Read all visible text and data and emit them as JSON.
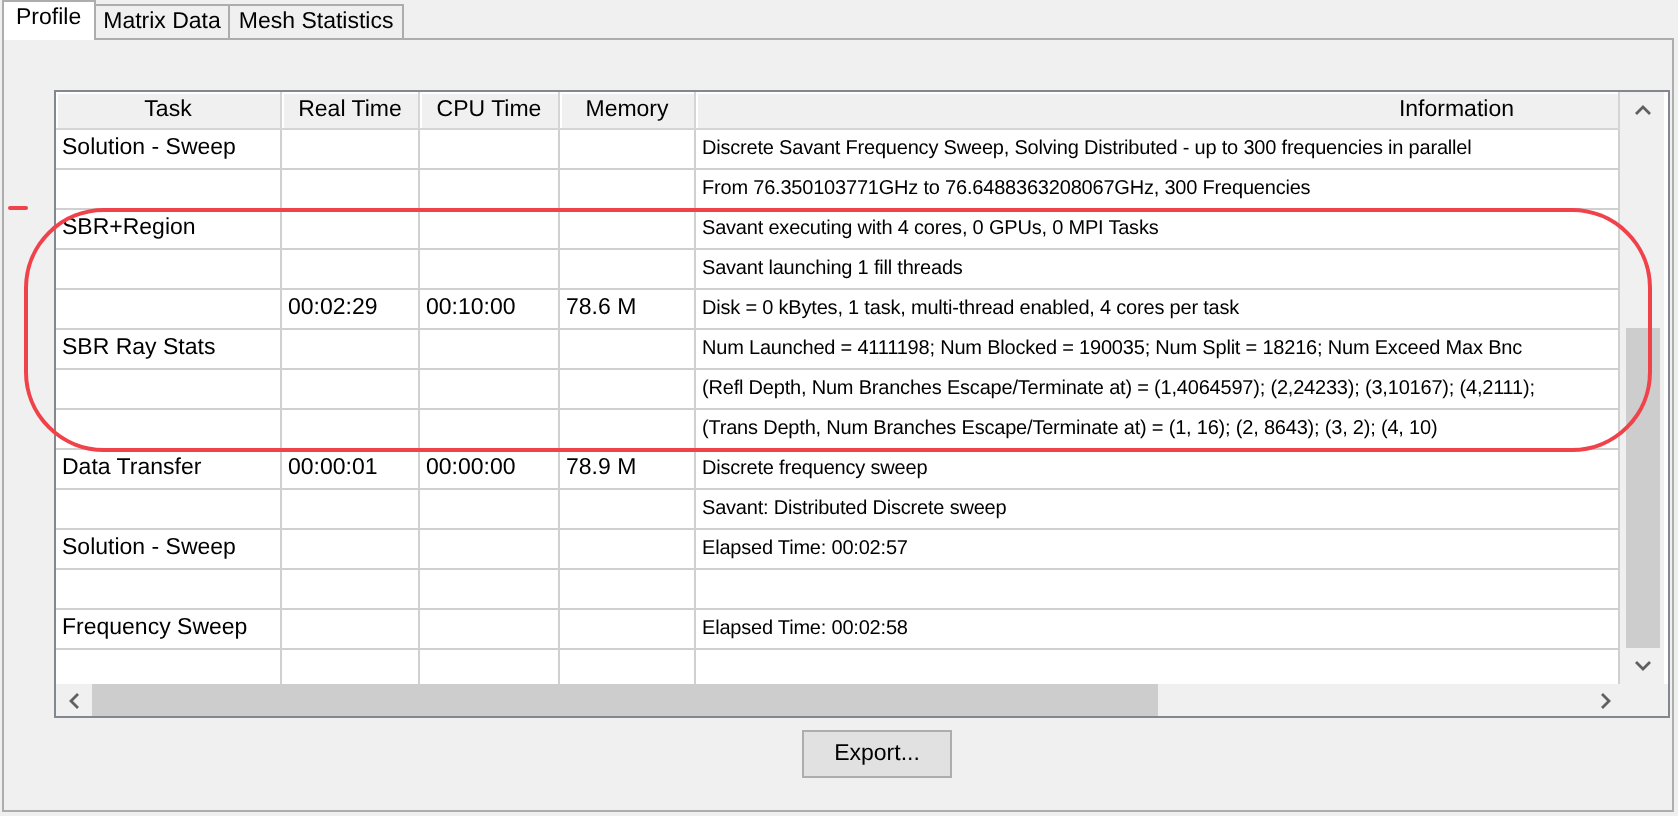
{
  "tabs": [
    {
      "label": "Profile",
      "selected": true
    },
    {
      "label": "Matrix Data",
      "selected": false
    },
    {
      "label": "Mesh Statistics",
      "selected": false
    }
  ],
  "table": {
    "columns": [
      "Task",
      "Real Time",
      "CPU Time",
      "Memory",
      "Information"
    ],
    "rows": [
      [
        "Solution - Sweep",
        "",
        "",
        "",
        "Discrete Savant Frequency Sweep, Solving Distributed - up to 300 frequencies in parallel"
      ],
      [
        "",
        "",
        "",
        "",
        "From 76.350103771GHz to 76.6488363208067GHz, 300 Frequencies"
      ],
      [
        "SBR+Region",
        "",
        "",
        "",
        "Savant executing with 4 cores, 0 GPUs, 0 MPI Tasks"
      ],
      [
        "",
        "",
        "",
        "",
        "Savant launching 1 fill threads"
      ],
      [
        "",
        "00:02:29",
        "00:10:00",
        "78.6 M",
        "Disk = 0 kBytes, 1 task, multi-thread enabled, 4 cores per task"
      ],
      [
        "SBR Ray Stats",
        "",
        "",
        "",
        "Num Launched = 4111198; Num Blocked = 190035; Num Split = 18216; Num Exceed Max Bnc"
      ],
      [
        "",
        "",
        "",
        "",
        "(Refl Depth, Num Branches Escape/Terminate at) = (1,4064597); (2,24233); (3,10167); (4,2111);"
      ],
      [
        "",
        "",
        "",
        "",
        "(Trans Depth, Num Branches Escape/Terminate at) = (1, 16); (2, 8643); (3, 2); (4, 10)"
      ],
      [
        "Data Transfer",
        "00:00:01",
        "00:00:00",
        "78.9 M",
        "Discrete frequency sweep"
      ],
      [
        "",
        "",
        "",
        "",
        "Savant: Distributed Discrete sweep"
      ],
      [
        "Solution - Sweep",
        "",
        "",
        "",
        "Elapsed Time: 00:02:57"
      ],
      [
        "",
        "",
        "",
        "",
        ""
      ],
      [
        "Frequency Sweep",
        "",
        "",
        "",
        "Elapsed Time: 00:02:58"
      ],
      [
        "",
        "",
        "",
        "",
        ""
      ]
    ]
  },
  "export_button": "Export..."
}
